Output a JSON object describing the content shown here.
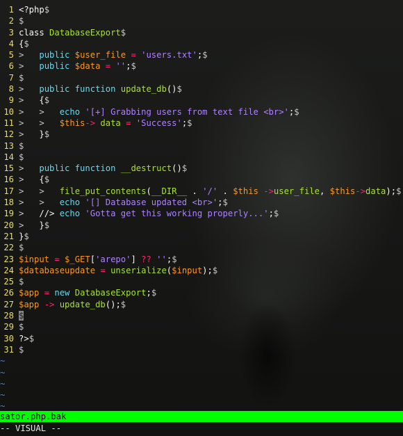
{
  "editor": {
    "lines": [
      {
        "n": "1",
        "parts": [
          [
            "pl",
            "<?php"
          ],
          [
            "eol",
            "$"
          ]
        ]
      },
      {
        "n": "2",
        "parts": [
          [
            "eol",
            "$"
          ]
        ]
      },
      {
        "n": "3",
        "parts": [
          [
            "pl",
            "class "
          ],
          [
            "fn",
            "DatabaseExport"
          ],
          [
            "eol",
            "$"
          ]
        ]
      },
      {
        "n": "4",
        "parts": [
          [
            "pl",
            "{"
          ],
          [
            "eol",
            "$"
          ]
        ]
      },
      {
        "n": "5",
        "parts": [
          [
            "ind",
            ">   "
          ],
          [
            "kw",
            "public "
          ],
          [
            "var",
            "$user_file"
          ],
          [
            "op",
            " = "
          ],
          [
            "str2",
            "'users.txt'"
          ],
          [
            "pl",
            ";"
          ],
          [
            "eol",
            "$"
          ]
        ]
      },
      {
        "n": "6",
        "parts": [
          [
            "ind",
            ">   "
          ],
          [
            "kw",
            "public "
          ],
          [
            "var",
            "$data"
          ],
          [
            "op",
            " = "
          ],
          [
            "str2",
            "''"
          ],
          [
            "pl",
            ";"
          ],
          [
            "eol",
            "$"
          ]
        ]
      },
      {
        "n": "7",
        "parts": [
          [
            "eol",
            "$"
          ]
        ]
      },
      {
        "n": "8",
        "parts": [
          [
            "ind",
            ">   "
          ],
          [
            "kw",
            "public function "
          ],
          [
            "fn",
            "update_db"
          ],
          [
            "pl",
            "()"
          ],
          [
            "eol",
            "$"
          ]
        ]
      },
      {
        "n": "9",
        "parts": [
          [
            "ind",
            ">   "
          ],
          [
            "pl",
            "{"
          ],
          [
            "eol",
            "$"
          ]
        ]
      },
      {
        "n": "10",
        "parts": [
          [
            "ind",
            ">   >   "
          ],
          [
            "kw",
            "echo "
          ],
          [
            "str2",
            "'[+] Grabbing users from text file <br>'"
          ],
          [
            "pl",
            ";"
          ],
          [
            "eol",
            "$"
          ]
        ]
      },
      {
        "n": "11",
        "parts": [
          [
            "ind",
            ">   >   "
          ],
          [
            "var",
            "$this"
          ],
          [
            "op",
            "-> "
          ],
          [
            "fn",
            "data"
          ],
          [
            "op",
            " = "
          ],
          [
            "str2",
            "'Success'"
          ],
          [
            "pl",
            ";"
          ],
          [
            "eol",
            "$"
          ]
        ]
      },
      {
        "n": "12",
        "parts": [
          [
            "ind",
            ">   "
          ],
          [
            "pl",
            "}"
          ],
          [
            "eol",
            "$"
          ]
        ]
      },
      {
        "n": "13",
        "parts": [
          [
            "eol",
            "$"
          ]
        ]
      },
      {
        "n": "14",
        "parts": [
          [
            "eol",
            "$"
          ]
        ]
      },
      {
        "n": "15",
        "parts": [
          [
            "ind",
            ">   "
          ],
          [
            "kw",
            "public function "
          ],
          [
            "fn",
            "__destruct"
          ],
          [
            "pl",
            "()"
          ],
          [
            "eol",
            "$"
          ]
        ]
      },
      {
        "n": "16",
        "parts": [
          [
            "ind",
            ">   "
          ],
          [
            "pl",
            "{"
          ],
          [
            "eol",
            "$"
          ]
        ]
      },
      {
        "n": "17",
        "parts": [
          [
            "ind",
            ">   >   "
          ],
          [
            "fn",
            "file_put_contents"
          ],
          [
            "pl",
            "("
          ],
          [
            "fn",
            "__DIR__"
          ],
          [
            "pl",
            " . "
          ],
          [
            "str2",
            "'/'"
          ],
          [
            "pl",
            " . "
          ],
          [
            "var",
            "$this"
          ],
          [
            "op",
            " ->"
          ],
          [
            "fn",
            "user_file"
          ],
          [
            "pl",
            ", "
          ],
          [
            "var",
            "$this"
          ],
          [
            "op",
            "->"
          ],
          [
            "fn",
            "data"
          ],
          [
            "pl",
            ");"
          ],
          [
            "eol",
            "$"
          ]
        ]
      },
      {
        "n": "18",
        "parts": [
          [
            "ind",
            ">   >   "
          ],
          [
            "kw",
            "echo "
          ],
          [
            "str2",
            "'[] Database updated <br>'"
          ],
          [
            "pl",
            ";"
          ],
          [
            "eol",
            "$"
          ]
        ]
      },
      {
        "n": "19",
        "parts": [
          [
            "ind",
            ">   "
          ],
          [
            "pl",
            "//> "
          ],
          [
            "kw",
            "echo "
          ],
          [
            "str2",
            "'Gotta get this working properly...'"
          ],
          [
            "pl",
            ";"
          ],
          [
            "eol",
            "$"
          ]
        ]
      },
      {
        "n": "20",
        "parts": [
          [
            "ind",
            ">   "
          ],
          [
            "pl",
            "}"
          ],
          [
            "eol",
            "$"
          ]
        ]
      },
      {
        "n": "21",
        "parts": [
          [
            "pl",
            "}"
          ],
          [
            "eol",
            "$"
          ]
        ]
      },
      {
        "n": "22",
        "parts": [
          [
            "eol",
            "$"
          ]
        ]
      },
      {
        "n": "23",
        "parts": [
          [
            "var",
            "$input"
          ],
          [
            "op",
            " = "
          ],
          [
            "var",
            "$_GET"
          ],
          [
            "pl",
            "["
          ],
          [
            "str2",
            "'arepo'"
          ],
          [
            "pl",
            "] "
          ],
          [
            "op",
            "??"
          ],
          [
            "pl",
            " "
          ],
          [
            "str2",
            "''"
          ],
          [
            "pl",
            ";"
          ],
          [
            "eol",
            "$"
          ]
        ]
      },
      {
        "n": "24",
        "parts": [
          [
            "var",
            "$databaseupdate"
          ],
          [
            "op",
            " = "
          ],
          [
            "fn",
            "unserialize"
          ],
          [
            "pl",
            "("
          ],
          [
            "var",
            "$input"
          ],
          [
            "pl",
            ");"
          ],
          [
            "eol",
            "$"
          ]
        ]
      },
      {
        "n": "25",
        "parts": [
          [
            "eol",
            "$"
          ]
        ]
      },
      {
        "n": "26",
        "parts": [
          [
            "var",
            "$app"
          ],
          [
            "op",
            " = "
          ],
          [
            "kw",
            "new "
          ],
          [
            "fn",
            "DatabaseExport"
          ],
          [
            "pl",
            ";"
          ],
          [
            "eol",
            "$"
          ]
        ]
      },
      {
        "n": "27",
        "parts": [
          [
            "var",
            "$app"
          ],
          [
            "op",
            " -> "
          ],
          [
            "fn",
            "update_db"
          ],
          [
            "pl",
            "();"
          ],
          [
            "eol",
            "$"
          ]
        ]
      },
      {
        "n": "28",
        "parts": [
          [
            "cur",
            "$"
          ]
        ]
      },
      {
        "n": "29",
        "parts": [
          [
            "eol",
            "$"
          ]
        ]
      },
      {
        "n": "30",
        "parts": [
          [
            "pl",
            "?>"
          ],
          [
            "eol",
            "$"
          ]
        ]
      },
      {
        "n": "31",
        "parts": [
          [
            "eol",
            "$"
          ]
        ]
      }
    ],
    "empty_marker": "~",
    "empty_count": 5
  },
  "statusline": {
    "filename": "sator.php.bak"
  },
  "modeline": {
    "mode": "-- VISUAL --"
  },
  "colors": {
    "statusline_bg": "#00ff00",
    "line_number": "#e6db74",
    "keyword": "#66d9ef",
    "function": "#a6e22e",
    "variable": "#fd971f",
    "string": "#ae81ff",
    "operator": "#f92672"
  }
}
